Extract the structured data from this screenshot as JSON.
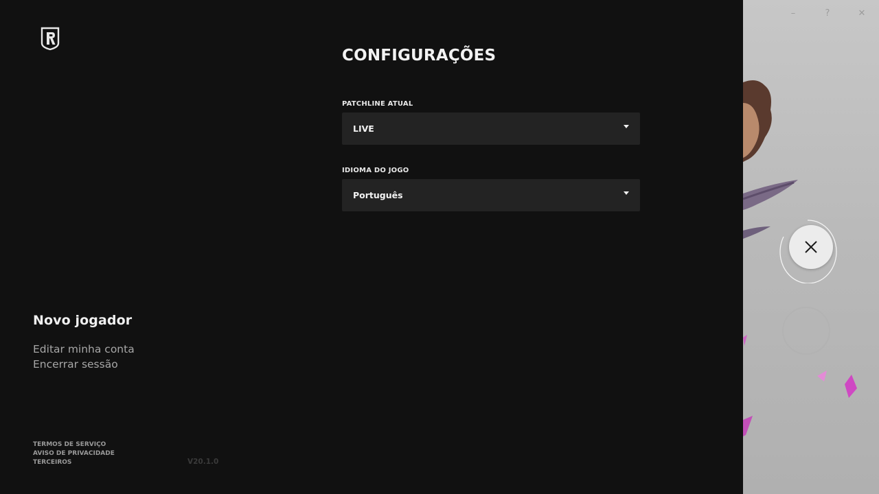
{
  "app": {
    "brand_icon": "riot-r-logo-icon"
  },
  "settings": {
    "title": "CONFIGURAÇÕES",
    "patchline": {
      "label": "PATCHLINE ATUAL",
      "value": "LIVE"
    },
    "language": {
      "label": "IDIOMA DO JOGO",
      "value": "Português"
    }
  },
  "profile": {
    "player_name": "Novo jogador",
    "links": [
      "Editar minha conta",
      "Encerrar sessão"
    ]
  },
  "legal": [
    "TERMOS DE SERVIÇO",
    "AVISO DE PRIVACIDADE",
    "TERCEIROS"
  ],
  "version": "V20.1.0",
  "window_controls": {
    "minimize": "–",
    "help": "?",
    "close": "✕"
  },
  "colors": {
    "background": "#111111",
    "dropdown": "#232323",
    "art_panel": "#bdbdbd",
    "accent_pink": "#c94fc4"
  }
}
